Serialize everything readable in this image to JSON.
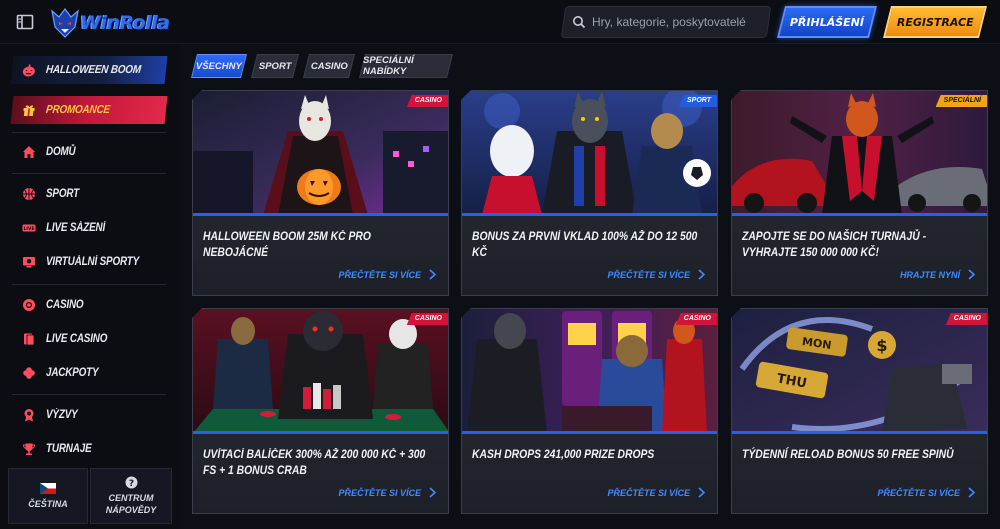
{
  "header": {
    "logo_text": "WinRolla",
    "search_placeholder": "Hry, kategorie, poskytovatelé",
    "login_label": "PŘIHLÁŠENÍ",
    "register_label": "REGISTRACE"
  },
  "sidebar": {
    "items": [
      {
        "label": "HALLOWEEN BOOM",
        "icon": "pumpkin-icon"
      },
      {
        "label": "PROMOANCE",
        "icon": "gift-icon"
      },
      {
        "label": "DOMŮ",
        "icon": "home-icon"
      },
      {
        "label": "SPORT",
        "icon": "basketball-icon"
      },
      {
        "label": "LIVE SÁZENÍ",
        "icon": "live-icon"
      },
      {
        "label": "VIRTUÁLNÍ SPORTY",
        "icon": "virtual-sports-icon"
      },
      {
        "label": "CASINO",
        "icon": "casino-chip-icon"
      },
      {
        "label": "LIVE CASINO",
        "icon": "cards-icon"
      },
      {
        "label": "JACKPOTY",
        "icon": "clover-icon"
      },
      {
        "label": "VÝZVY",
        "icon": "badge-icon"
      },
      {
        "label": "TURNAJE",
        "icon": "trophy-icon"
      }
    ],
    "language_label": "ČEŠTINA",
    "help_label_1": "CENTRUM",
    "help_label_2": "NÁPOVĚDY"
  },
  "filters": [
    "VŠECHNY",
    "SPORT",
    "CASINO",
    "SPECIÁLNÍ NABÍDKY"
  ],
  "promos": [
    {
      "tag": "CASINO",
      "title": "HALLOWEEN BOOM 25M KČ PRO NEBOJÁCNÉ",
      "link": "PŘEČTĚTE SI VÍCE"
    },
    {
      "tag": "SPORT",
      "title": "BONUS ZA PRVNÍ VKLAD 100% AŽ DO 12 500 KČ",
      "link": "PŘEČTĚTE SI VÍCE"
    },
    {
      "tag": "SPECIÁLNÍ",
      "title": "ZAPOJTE SE DO NAŠICH TURNAJŮ - VYHRAJTE 150 000 000 KČ!",
      "link": "HRAJTE NYNÍ"
    },
    {
      "tag": "CASINO",
      "title": "UVÍTACÍ BALÍČEK 300% AŽ 200 000 KČ + 300 FS + 1 BONUS CRAB",
      "link": "PŘEČTĚTE SI VÍCE"
    },
    {
      "tag": "CASINO",
      "title": "KASH DROPS 241,000 PRIZE DROPS",
      "link": "PŘEČTĚTE SI VÍCE"
    },
    {
      "tag": "CASINO",
      "title": "TÝDENNÍ RELOAD BONUS 50 FREE SPINŮ",
      "link": "PŘEČTĚTE SI VÍCE"
    }
  ],
  "image_text": {
    "mon": "MON",
    "thu": "THU"
  }
}
